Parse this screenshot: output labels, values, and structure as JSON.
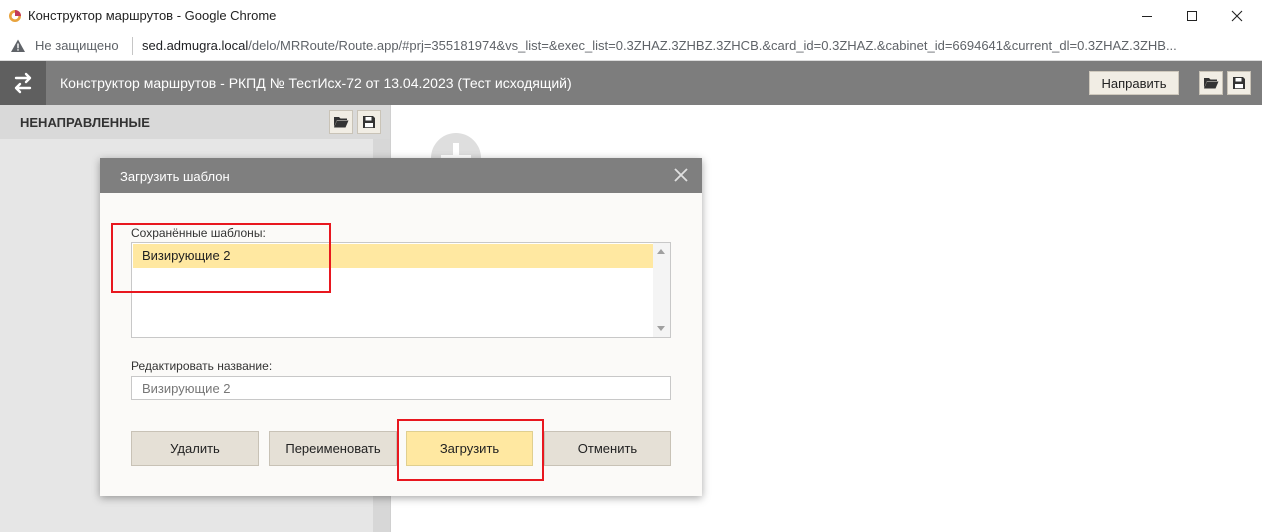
{
  "browser": {
    "window_title": "Конструктор маршрутов - Google Chrome",
    "security_label": "Не защищено",
    "url_host": "sed.admugra.local",
    "url_rest": "/delo/MRRoute/Route.app/#prj=355181974&vs_list=&exec_list=0.3ZHAZ.3ZHBZ.3ZHCB.&card_id=0.3ZHAZ.&cabinet_id=6694641&current_dl=0.3ZHAZ.3ZHB..."
  },
  "app": {
    "title": "Конструктор маршрутов - РКПД № ТестИсх-72 от 13.04.2023 (Тест исходящий)",
    "send_label": "Направить"
  },
  "left_panel": {
    "heading": "НЕНАПРАВЛЕННЫЕ"
  },
  "dialog": {
    "title": "Загрузить шаблон",
    "saved_label": "Сохранённые шаблоны:",
    "templates": [
      "Визирующие 2"
    ],
    "selected_template": "Визирующие 2",
    "edit_label": "Редактировать название:",
    "edit_value": "Визирующие 2",
    "buttons": {
      "delete": "Удалить",
      "rename": "Переименовать",
      "load": "Загрузить",
      "cancel": "Отменить"
    }
  },
  "colors": {
    "header_gray": "#7d7d7d",
    "selection_yellow": "#ffe8a1",
    "annotation_red": "#e8171f"
  }
}
